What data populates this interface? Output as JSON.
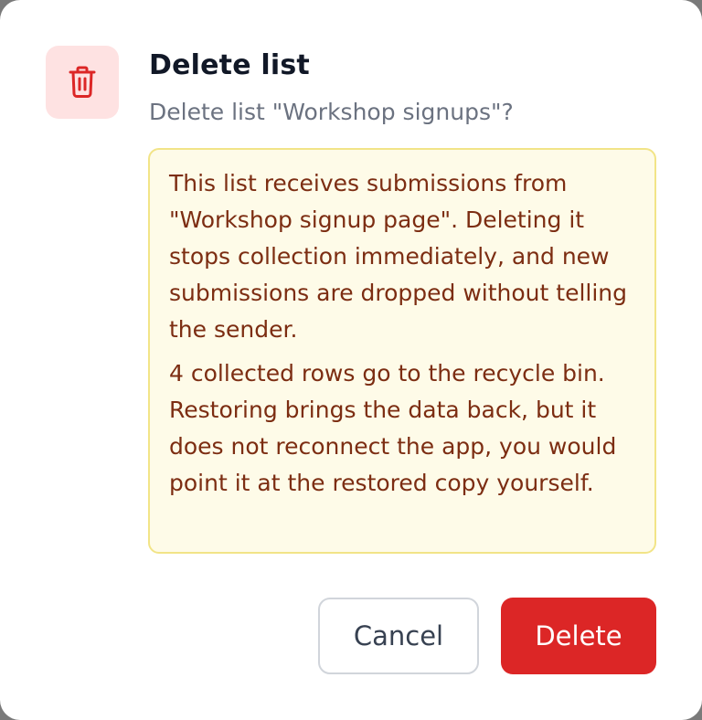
{
  "dialog": {
    "icon": "trash-icon",
    "title": "Delete list",
    "subtitle": "Delete list \"Workshop signups\"?",
    "warning": {
      "paragraph_1": "This list receives submissions from \"Workshop signup page\". Deleting it stops collection immediately, and new submissions are dropped without telling the sender.",
      "paragraph_2": "4 collected rows go to the recycle bin. Restoring brings the data back, but it does not reconnect the app, you would point it at the restored copy yourself."
    },
    "buttons": {
      "cancel_label": "Cancel",
      "delete_label": "Delete"
    }
  },
  "colors": {
    "danger": "#dc2626",
    "icon_background": "#fee2e2",
    "warning_background": "#fefbe8",
    "warning_border": "#f2e487",
    "warning_text": "#7c2d12",
    "title_text": "#111827",
    "muted_text": "#6b7280"
  }
}
